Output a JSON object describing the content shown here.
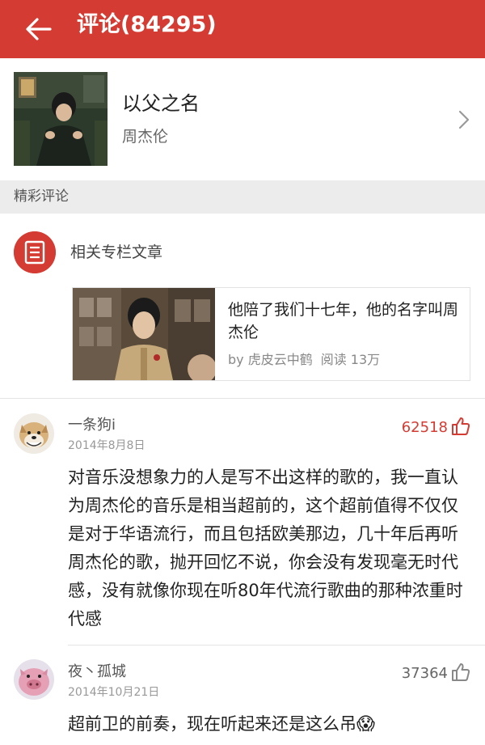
{
  "header": {
    "title": "评论(84295)",
    "bg_color": "#d43c33",
    "back_icon": "arrow-left-icon"
  },
  "song": {
    "title": "以父之名",
    "artist": "周杰伦"
  },
  "section": {
    "label": "精彩评论"
  },
  "related": {
    "label": "相关专栏文章",
    "icon": "article-icon",
    "article": {
      "title": "他陪了我们十七年，他的名字叫周杰伦",
      "author": "by 虎皮云中鹤",
      "reads": "阅读 13万"
    }
  },
  "comments": [
    {
      "user": "一条狗i",
      "date": "2014年8月8日",
      "likes": "62518",
      "liked": true,
      "text": "对音乐没想象力的人是写不出这样的歌的，我一直认为周杰伦的音乐是相当超前的，这个超前值得不仅仅是对于华语流行，而且包括欧美那边，几十年后再听周杰伦的歌，抛开回忆不说，你会没有发现毫无时代感，没有就像你现在听80年代流行歌曲的那种浓重时代感"
    },
    {
      "user": "夜丶孤城",
      "date": "2014年10月21日",
      "likes": "37364",
      "liked": false,
      "text": "超前卫的前奏，现在听起来还是这么吊",
      "emoji": "😱"
    }
  ]
}
